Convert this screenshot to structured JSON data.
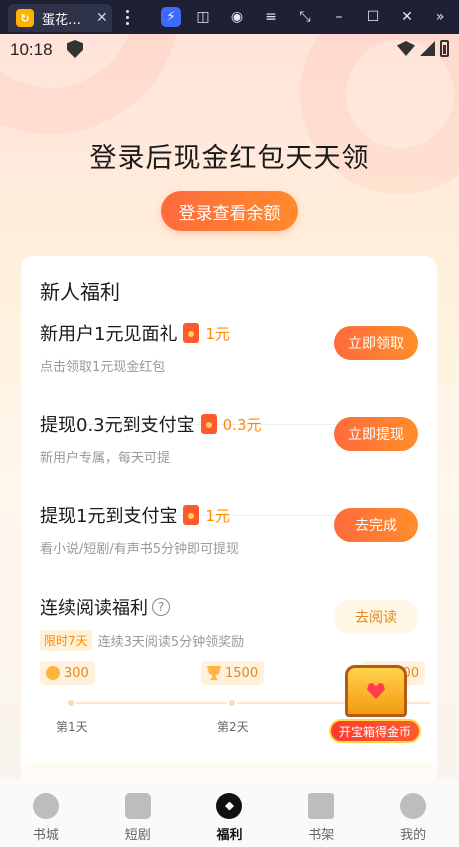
{
  "emulator": {
    "tab_title": "蛋花…",
    "tab_icon": "app-logo-icon"
  },
  "status_bar": {
    "time": "10:18"
  },
  "hero": {
    "title": "登录后现金红包天天领",
    "login_button": "登录查看余额"
  },
  "newcomer": {
    "title": "新人福利",
    "tasks": [
      {
        "title": "新用户1元见面礼",
        "reward": "1元",
        "desc": "点击领取1元现金红包",
        "button": "立即领取"
      },
      {
        "title": "提现0.3元到支付宝",
        "reward": "0.3元",
        "desc": "新用户专属，每天可提",
        "button": "立即提现"
      },
      {
        "title": "提现1元到支付宝",
        "reward": "1元",
        "desc": "看小说/短剧/有声书5分钟即可提现",
        "button": "去完成"
      }
    ],
    "reading": {
      "title": "连续阅读福利",
      "badge": "限时7天",
      "desc": "连续3天阅读5分钟领奖励",
      "button": "去阅读",
      "milestones": [
        {
          "coins": "300",
          "day": "第1天"
        },
        {
          "coins": "1500",
          "day": "第2天"
        },
        {
          "coins": "3000",
          "day": ""
        }
      ]
    }
  },
  "chest": {
    "label": "开宝箱得金币"
  },
  "tabbar": {
    "items": [
      {
        "label": "书城",
        "icon": "compass-icon"
      },
      {
        "label": "短剧",
        "icon": "play-icon"
      },
      {
        "label": "福利",
        "icon": "welfare-icon",
        "active": true
      },
      {
        "label": "书架",
        "icon": "book-icon"
      },
      {
        "label": "我的",
        "icon": "user-icon"
      }
    ]
  },
  "colors": {
    "accent": "#ff6a3d",
    "reward": "#ff8a00"
  }
}
